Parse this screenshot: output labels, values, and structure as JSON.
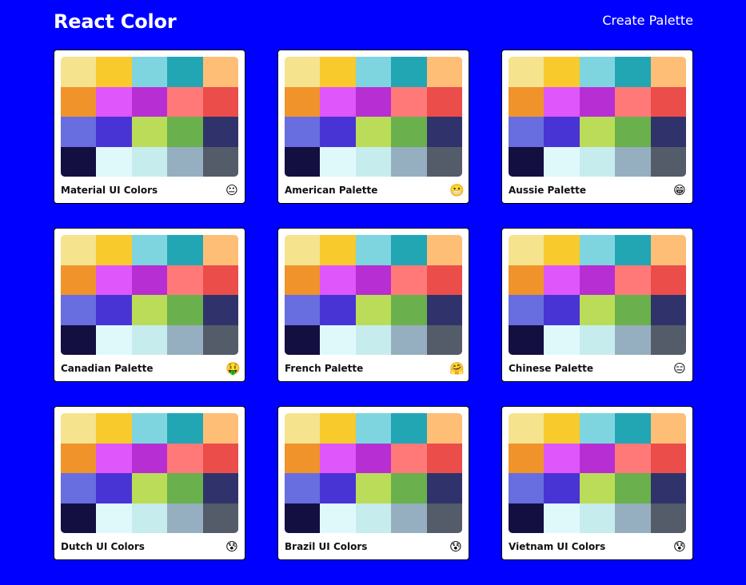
{
  "navbar": {
    "title": "React Color",
    "create_palette_label": "Create Palette"
  },
  "swatch_colors": [
    "#f6e38e",
    "#f9ca2c",
    "#7ed5df",
    "#22a6b3",
    "#ffbe76",
    "#f0932b",
    "#df57fb",
    "#b72ed3",
    "#ff7979",
    "#eb4d4b",
    "#686de0",
    "#4834d4",
    "#badc58",
    "#6ab04c",
    "#30336b",
    "#130f40",
    "#dff9fb",
    "#c7ecee",
    "#95afc0",
    "#535c68"
  ],
  "palettes": [
    {
      "name": "Material UI Colors",
      "emoji": "😐"
    },
    {
      "name": "American Palette",
      "emoji": "😬"
    },
    {
      "name": "Aussie Palette",
      "emoji": "😁"
    },
    {
      "name": "Canadian Palette",
      "emoji": "🤑"
    },
    {
      "name": "French Palette",
      "emoji": "🤗"
    },
    {
      "name": "Chinese Palette",
      "emoji": "😑"
    },
    {
      "name": "Dutch UI Colors",
      "emoji": "😰"
    },
    {
      "name": "Brazil UI Colors",
      "emoji": "😰"
    },
    {
      "name": "Vietnam UI Colors",
      "emoji": "😰"
    }
  ]
}
